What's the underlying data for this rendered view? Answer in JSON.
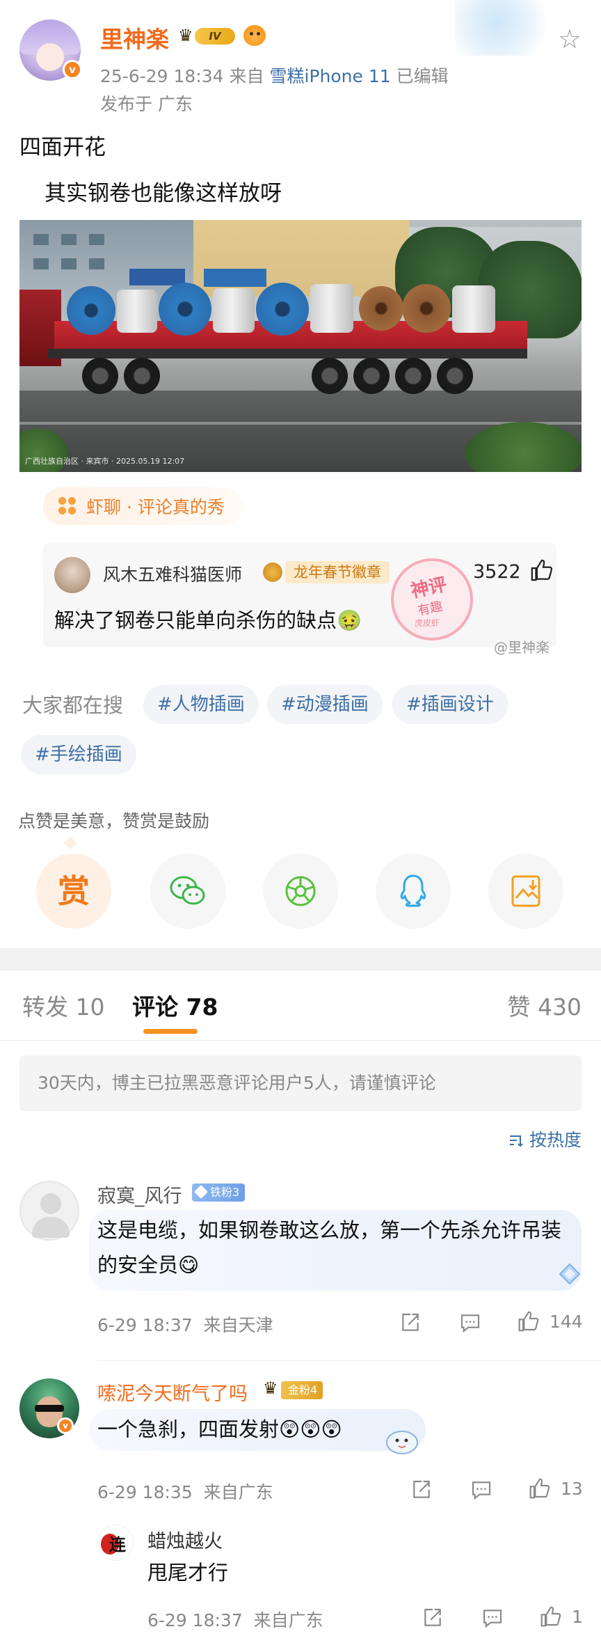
{
  "post": {
    "author": "里神楽",
    "level_badge": "IV",
    "timestamp": "25-6-29 18:34",
    "source_prefix": "来自",
    "source": "雪糕iPhone 11",
    "edited": "已编辑",
    "location": "发布于 广东",
    "text_line1": "四面开花",
    "text_line2": "其实钢卷也能像这样放呀",
    "photo_caption": "广西壮族自治区 · 来宾市 · 2025.05.19 12:07"
  },
  "hot": {
    "tag": "虾聊 · 评论真的秀",
    "user": "风木五难科猫医师",
    "medal": "龙年春节徽章",
    "likes": "3522",
    "text": "解决了钢卷只能单向杀伤的缺点🤢",
    "stamp_line1": "神评",
    "stamp_line2": "有趣",
    "stamp_line3": "虎皮虾",
    "watermark": "@里神楽"
  },
  "search": {
    "label": "大家都在搜",
    "tags": [
      "#人物插画",
      "#动漫插画",
      "#插画设计",
      "#手绘插画"
    ]
  },
  "share": {
    "encourage": "点赞是美意，赞赏是鼓励",
    "reward_label": "赏"
  },
  "tabs": {
    "forward": "转发 10",
    "comments": "评论 78",
    "likes": "赞 430"
  },
  "notice": "30天内，博主已拉黑恶意评论用户5人，请谨慎评论",
  "sort": "按热度",
  "comments": [
    {
      "user": "寂寞_风行",
      "fan_badge": "铁粉3",
      "text": "这是电缆，如果钢卷敢这么放，第一个先杀允许吊装的安全员😋",
      "time": "6-29 18:37",
      "location": "来自天津",
      "likes": "144"
    },
    {
      "user": "嗦泥今天断气了吗",
      "fan_badge": "金粉4",
      "text": "一个急刹，四面发射😲😲😲",
      "time": "6-29 18:35",
      "location": "来自广东",
      "likes": "13",
      "reply": {
        "user": "蜡烛越火",
        "text": "甩尾才行",
        "time": "6-29 18:37",
        "location": "来自广东",
        "likes": "1"
      }
    }
  ],
  "colors": {
    "accent_orange": "#f26a1b",
    "link_blue": "#3d6fa6",
    "tab_underline": "#f7901e"
  }
}
